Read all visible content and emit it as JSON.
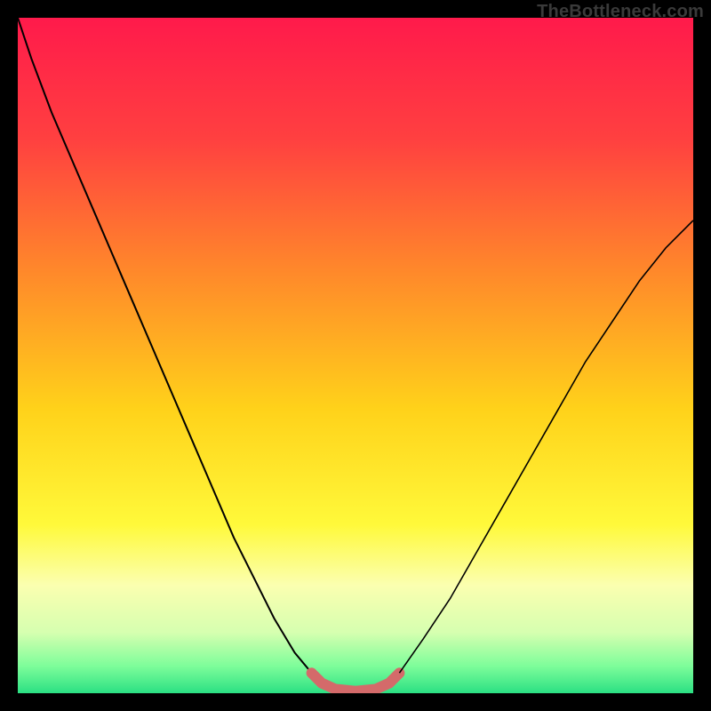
{
  "watermark": "TheBottleneck.com",
  "chart_data": {
    "type": "line",
    "title": "",
    "xlabel": "",
    "ylabel": "",
    "xlim": [
      0,
      100
    ],
    "ylim": [
      0,
      100
    ],
    "grid": false,
    "legend": false,
    "gradient_stops": [
      {
        "pct": 0,
        "color": "#ff1a4b"
      },
      {
        "pct": 18,
        "color": "#ff4040"
      },
      {
        "pct": 38,
        "color": "#ff8a2a"
      },
      {
        "pct": 58,
        "color": "#ffd21a"
      },
      {
        "pct": 75,
        "color": "#fff93a"
      },
      {
        "pct": 84,
        "color": "#fbffb0"
      },
      {
        "pct": 91,
        "color": "#d6ffb0"
      },
      {
        "pct": 96,
        "color": "#7dfd9a"
      },
      {
        "pct": 100,
        "color": "#2be083"
      }
    ],
    "series": [
      {
        "name": "left-arm",
        "stroke": "#000000",
        "width": 2.0,
        "x": [
          0,
          2,
          5,
          8,
          11,
          14,
          17,
          20,
          23,
          26,
          29,
          32,
          35,
          38,
          41,
          43.5
        ],
        "y": [
          100,
          94,
          86,
          79,
          72,
          65,
          58,
          51,
          44,
          37,
          30,
          23,
          17,
          11,
          6,
          3
        ]
      },
      {
        "name": "pink-bottom",
        "stroke": "#d46a6a",
        "width": 12,
        "linecap": "round",
        "x": [
          43.5,
          45,
          47,
          50,
          53,
          55,
          56.5
        ],
        "y": [
          3,
          1.5,
          0.6,
          0.3,
          0.6,
          1.5,
          3
        ]
      },
      {
        "name": "right-arm",
        "stroke": "#000000",
        "width": 1.6,
        "x": [
          56.5,
          60,
          64,
          68,
          72,
          76,
          80,
          84,
          88,
          92,
          96,
          100
        ],
        "y": [
          3,
          8,
          14,
          21,
          28,
          35,
          42,
          49,
          55,
          61,
          66,
          70
        ]
      }
    ]
  }
}
